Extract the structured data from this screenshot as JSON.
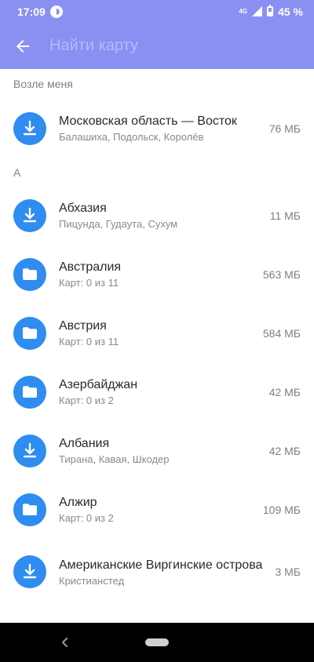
{
  "status_bar": {
    "time": "17:09",
    "network": "4G",
    "battery": "45 %"
  },
  "toolbar": {
    "search_placeholder": "Найти карту"
  },
  "sections": [
    {
      "title": "Возле меня",
      "items": [
        {
          "icon": "download-icon",
          "title": "Московская область — Восток",
          "subtitle": "Балашиха, Подольск, Королёв",
          "size": "76 МБ"
        }
      ]
    },
    {
      "title": "А",
      "items": [
        {
          "icon": "download-icon",
          "title": "Абхазия",
          "subtitle": "Пицунда, Гудаута, Сухум",
          "size": "11 МБ"
        },
        {
          "icon": "folder-icon",
          "title": "Австралия",
          "subtitle": "Карт: 0 из 11",
          "size": "563 МБ"
        },
        {
          "icon": "folder-icon",
          "title": "Австрия",
          "subtitle": "Карт: 0 из 11",
          "size": "584 МБ"
        },
        {
          "icon": "folder-icon",
          "title": "Азербайджан",
          "subtitle": "Карт: 0 из 2",
          "size": "42 МБ"
        },
        {
          "icon": "download-icon",
          "title": "Албания",
          "subtitle": "Тирана, Кавая, Шкодер",
          "size": "42 МБ"
        },
        {
          "icon": "folder-icon",
          "title": "Алжир",
          "subtitle": "Карт: 0 из 2",
          "size": "109 МБ"
        },
        {
          "icon": "download-icon",
          "title": "Американские Виргинские острова",
          "subtitle": "Кристианстед",
          "size": "3 МБ"
        }
      ]
    }
  ],
  "colors": {
    "accent": "#8a90f2",
    "icon_bg": "#2f8cf0"
  }
}
